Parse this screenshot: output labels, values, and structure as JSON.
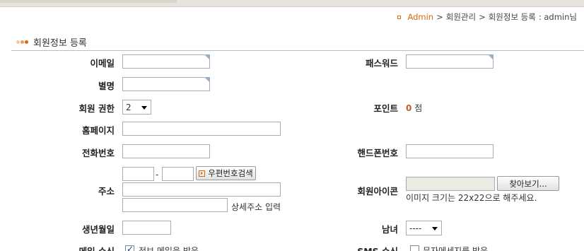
{
  "breadcrumb": {
    "home": "Admin",
    "sep1": ">",
    "level1": "회원관리",
    "sep2": ">",
    "level2": "회원정보 등록",
    "user": ": admin님"
  },
  "section": {
    "title": "회원정보 등록"
  },
  "form": {
    "email_label": "이메일",
    "password_label": "패스워드",
    "nickname_label": "별명",
    "level_label": "회원 권한",
    "level_value": "2",
    "points_label": "포인트",
    "points_value": "0",
    "points_unit": "점",
    "homepage_label": "홈페이지",
    "phone_label": "전화번호",
    "mobile_label": "핸드폰번호",
    "address_label": "주소",
    "zip_dash": "-",
    "zip_search_label": "우편번호검색",
    "address_detail_hint": "상세주소 입력",
    "icon_label": "회원아이콘",
    "browse_label": "찾아보기...",
    "icon_hint": "이미지 크기는 22x22으로 해주세요.",
    "birthday_label": "생년월일",
    "gender_label": "남녀",
    "gender_value": "----",
    "mailing_label": "메일 수신",
    "mailing_option": "정보 메일을 받음",
    "mailing_checked": true,
    "sms_label": "SMS 수신",
    "sms_option": "문자메세지를 받음",
    "sms_checked": false
  },
  "colors": {
    "accent": "#d9690c",
    "border": "#a5acb5"
  }
}
